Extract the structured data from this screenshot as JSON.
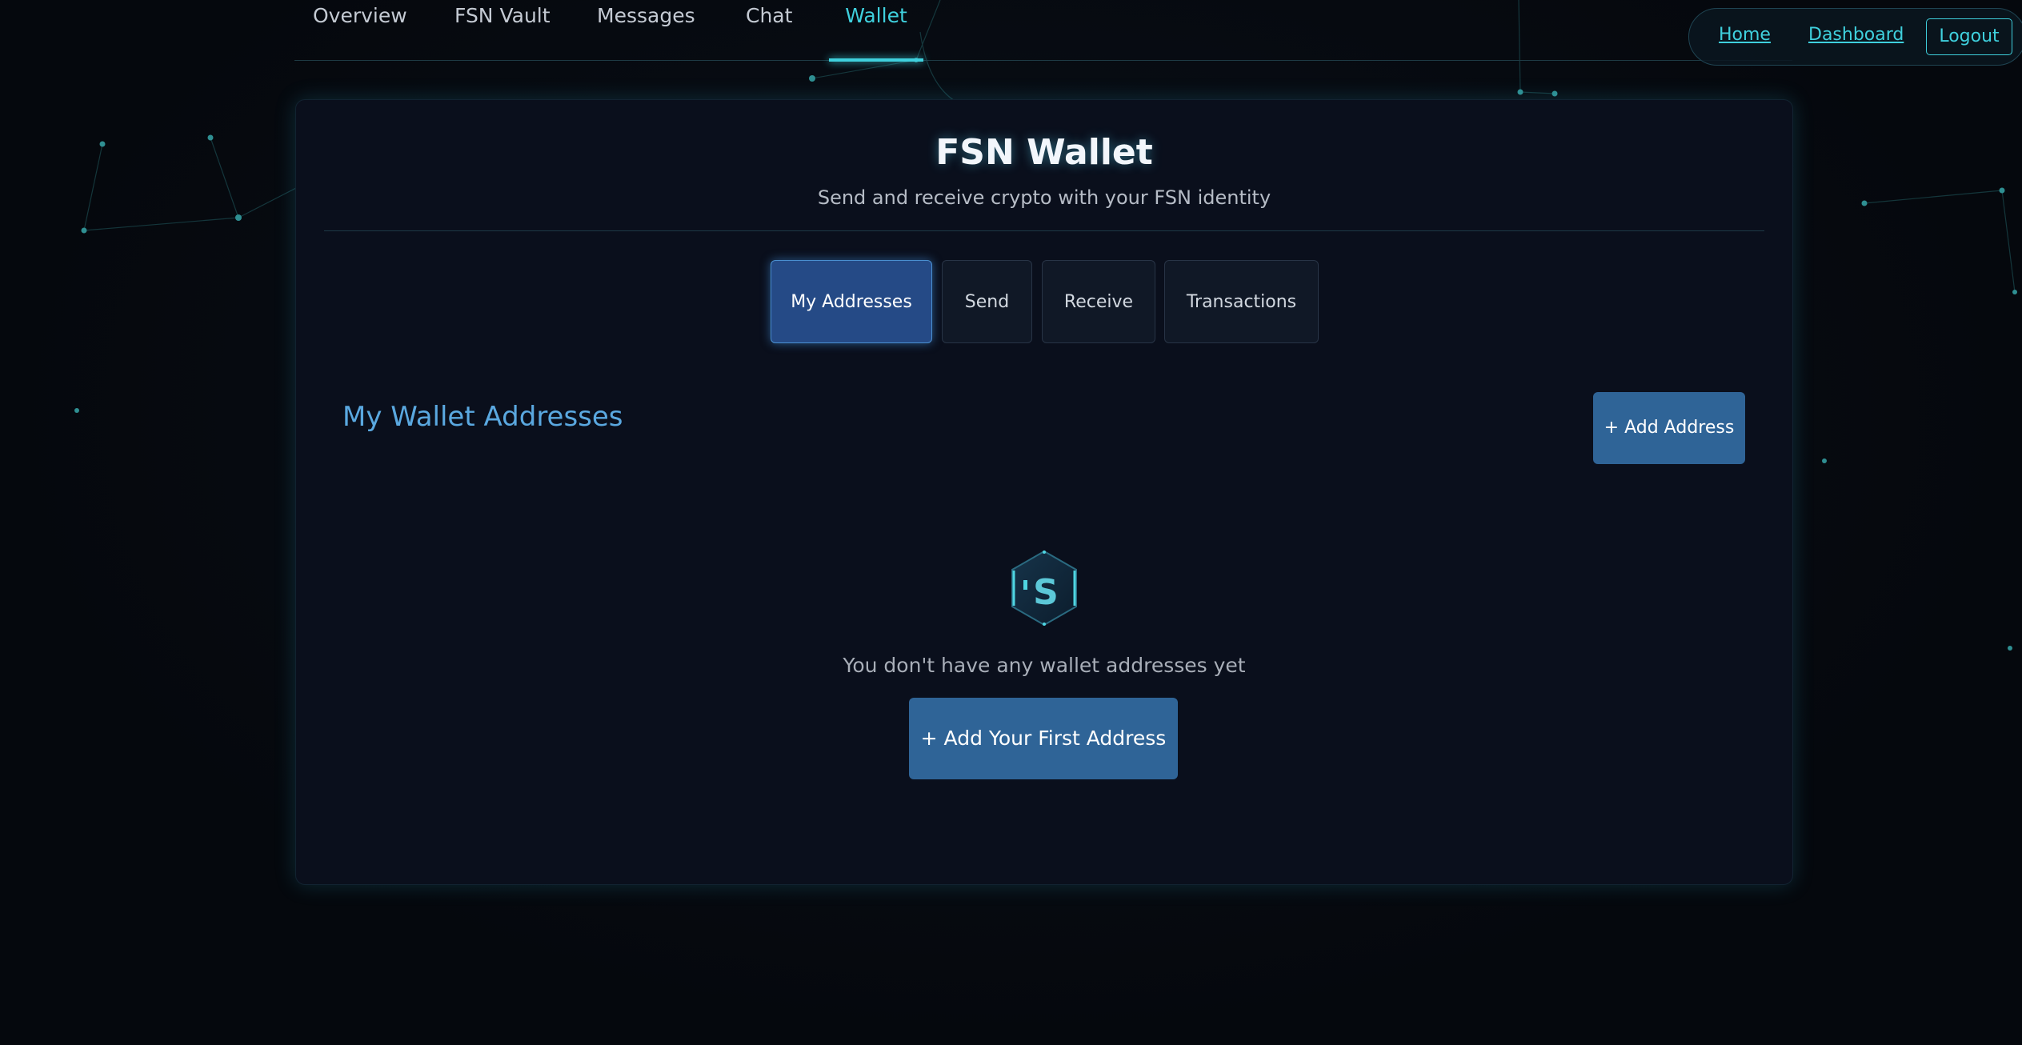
{
  "nav": {
    "items": [
      {
        "label": "Overview"
      },
      {
        "label": "FSN Vault"
      },
      {
        "label": "Messages"
      },
      {
        "label": "Chat"
      },
      {
        "label": "Wallet"
      }
    ],
    "active": "Wallet"
  },
  "header_links": {
    "home": "Home",
    "dashboard": "Dashboard",
    "logout": "Logout"
  },
  "wallet": {
    "title": "FSN Wallet",
    "subtitle": "Send and receive crypto with your FSN identity",
    "tabs": [
      {
        "label": "My Addresses"
      },
      {
        "label": "Send"
      },
      {
        "label": "Receive"
      },
      {
        "label": "Transactions"
      }
    ],
    "active_tab": "My Addresses",
    "section_heading": "My Wallet Addresses",
    "add_button": "+ Add Address",
    "empty_icon_letter": "S",
    "empty_message": "You don't have any wallet addresses yet",
    "first_address_button": "+ Add Your First Address"
  },
  "colors": {
    "accent_cyan": "#3fd0dd",
    "heading_blue": "#5aa8e0",
    "button_blue": "#2f6497",
    "active_tab": "#254a86",
    "panel_bg": "#0a0f1c",
    "page_bg": "#05080d"
  }
}
